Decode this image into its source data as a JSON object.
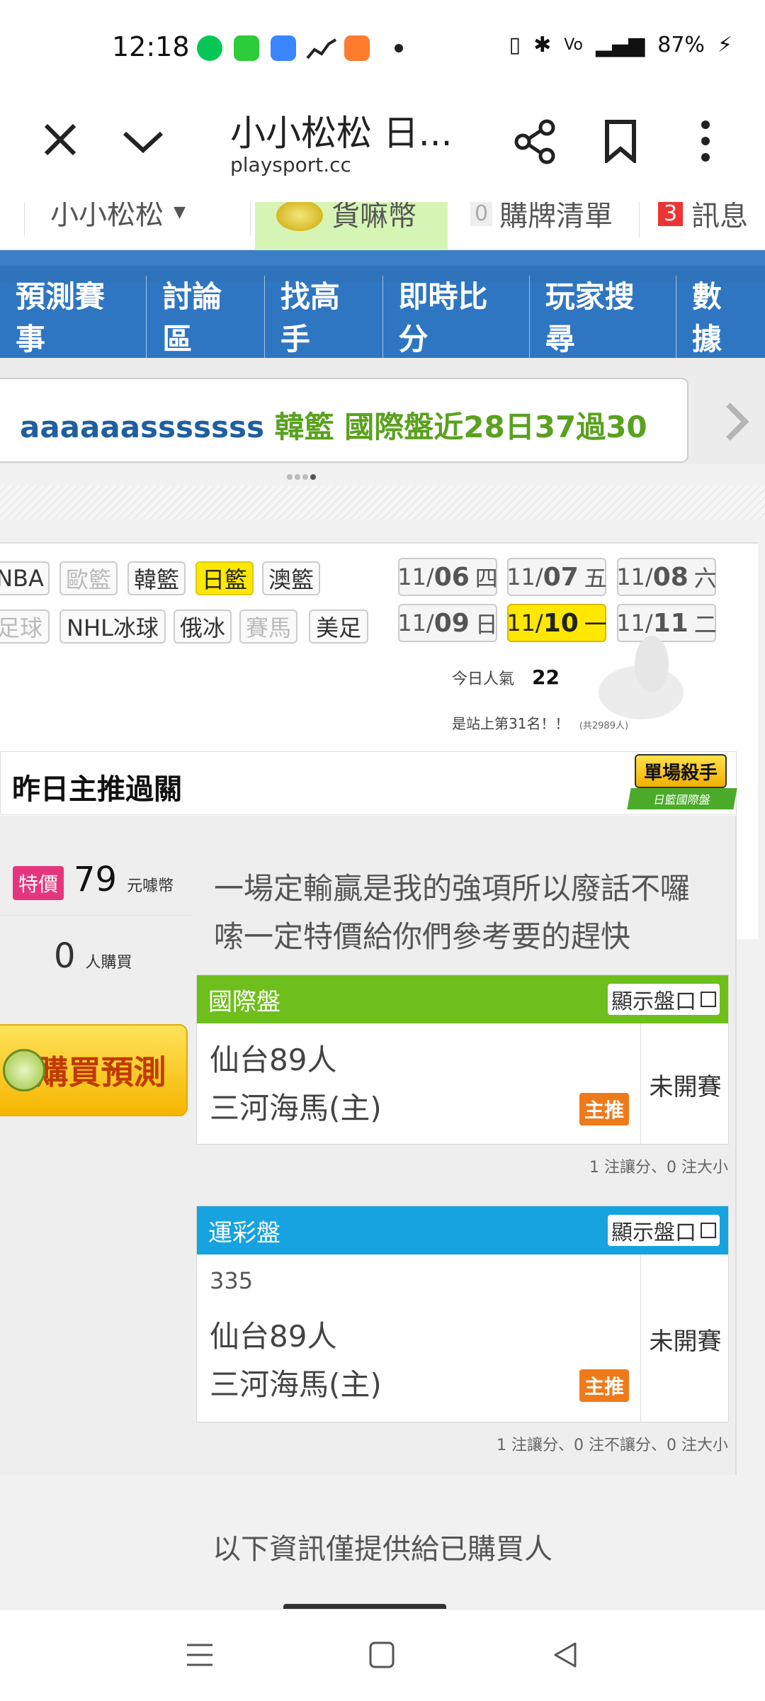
{
  "status": {
    "time": "12:18",
    "battery": "87%",
    "apps": [
      {
        "name": "line-app-icon",
        "color": "#06c755"
      },
      {
        "name": "grid-app-icon",
        "color": "#2dcc3a"
      },
      {
        "name": "square-app-icon",
        "color": "#3a86ff"
      },
      {
        "name": "chart-app-icon",
        "color": "#222222"
      },
      {
        "name": "game-app-icon",
        "color": "#ff7b2d"
      }
    ]
  },
  "browser": {
    "title": "小小松松 日...",
    "url": "playsport.cc"
  },
  "topstrip": {
    "user": "小小松松",
    "coin": "貨嘛幣",
    "cart_count": "0",
    "cart": "購牌清單",
    "msg_count": "3",
    "msg": "訊息"
  },
  "nav": [
    "預測賽事",
    "討論區",
    "找高手",
    "即時比分",
    "玩家搜尋",
    "數據"
  ],
  "ticker": {
    "user": "aaaaaasssssss",
    "text": "韓籃 國際盤近28日37過30"
  },
  "sports_row1": [
    {
      "label": "NBA",
      "state": "normal"
    },
    {
      "label": "歐籃",
      "state": "disabled"
    },
    {
      "label": "韓籃",
      "state": "normal"
    },
    {
      "label": "日籃",
      "state": "active"
    },
    {
      "label": "澳籃",
      "state": "normal"
    }
  ],
  "sports_row2": [
    {
      "label": "足球",
      "state": "disabled"
    },
    {
      "label": "NHL冰球",
      "state": "normal"
    },
    {
      "label": "俄冰",
      "state": "normal"
    },
    {
      "label": "賽馬",
      "state": "disabled"
    },
    {
      "label": "美足",
      "state": "normal"
    }
  ],
  "dates": [
    {
      "month": "11/",
      "day": "06",
      "wd": "四",
      "active": false
    },
    {
      "month": "11/",
      "day": "07",
      "wd": "五",
      "active": false
    },
    {
      "month": "11/",
      "day": "08",
      "wd": "六",
      "active": false
    },
    {
      "month": "11/",
      "day": "09",
      "wd": "日",
      "active": false
    },
    {
      "month": "11/",
      "day": "10",
      "wd": "一",
      "active": true
    },
    {
      "month": "11/",
      "day": "11",
      "wd": "二",
      "active": false
    }
  ],
  "popularity": {
    "label": "今日人氣",
    "value": "22",
    "rank_text": "是站上第31名！！",
    "total": "(共2989人)"
  },
  "section": {
    "title": "昨日主推過關",
    "badge_top": "單場殺手",
    "badge_bottom": "日籃國際盤"
  },
  "offer": {
    "tag": "特價",
    "price": "79",
    "unit": "元噱幣",
    "buyers": "0",
    "buyers_unit": "人購買",
    "buy_label": "購買預測"
  },
  "description": "一場定輸贏是我的強項所以廢話不囉嗦一定特價給你們參考要的趕快",
  "markets": [
    {
      "title": "國際盤",
      "color": "#6fbf1c",
      "show": "顯示盤口",
      "code": "",
      "away": "仙台89人",
      "home": "三河海馬(主)",
      "tag": "主推",
      "status": "未開賽",
      "note": "1 注讓分、0 注大小"
    },
    {
      "title": "運彩盤",
      "color": "#17a2e0",
      "show": "顯示盤口",
      "code": "335",
      "away": "仙台89人",
      "home": "三河海馬(主)",
      "tag": "主推",
      "status": "未開賽",
      "note": "1 注讓分、0 注不讓分、0 注大小"
    }
  ],
  "notice": "以下資訊僅提供給已購買人"
}
